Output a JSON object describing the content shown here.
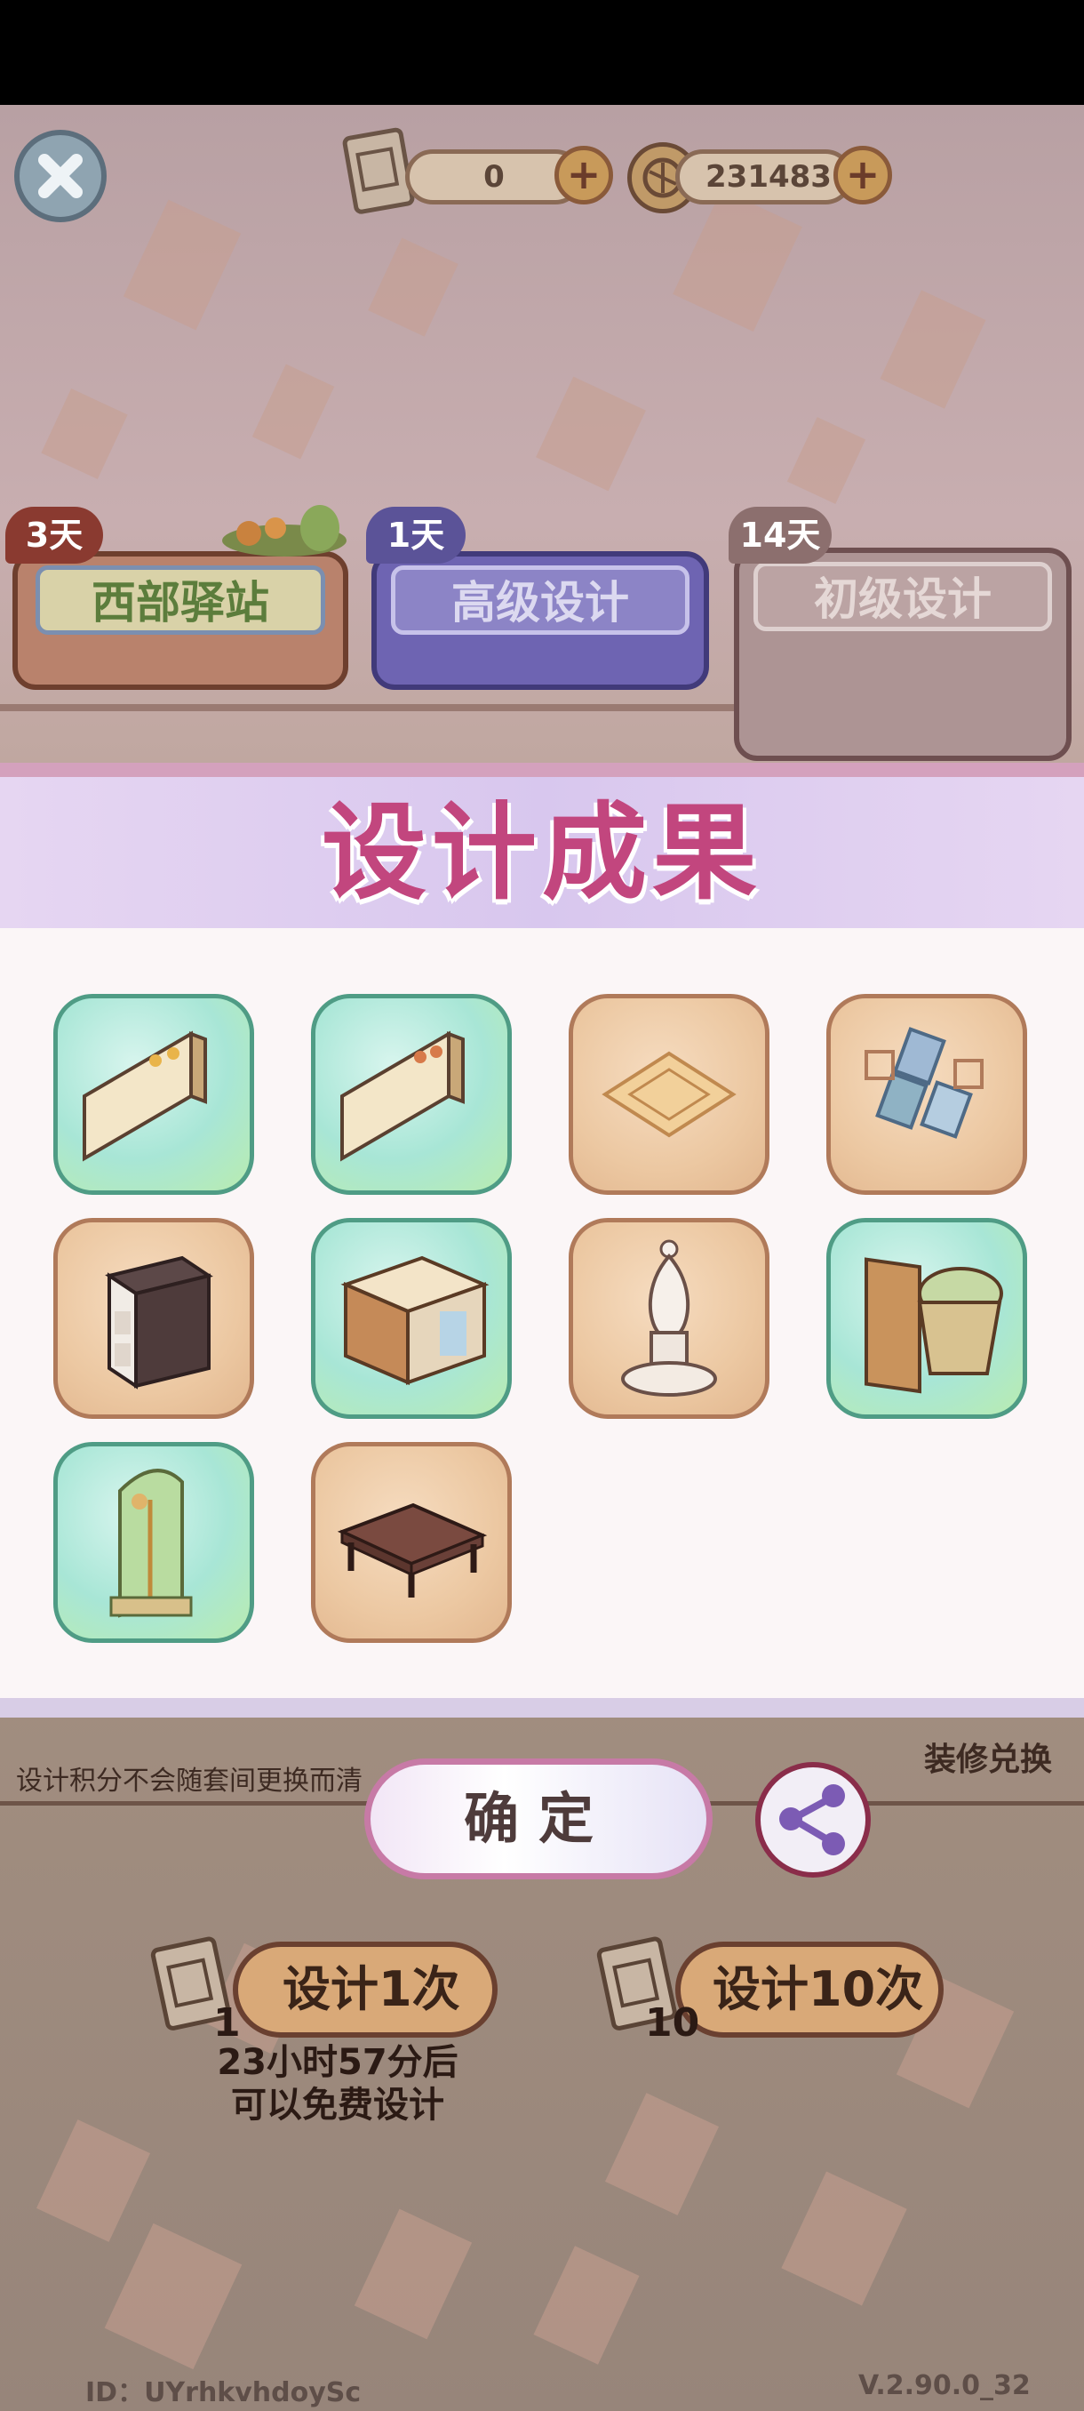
{
  "top_bar": {
    "scroll_count": "0",
    "coin_count": "231483"
  },
  "tabs": [
    {
      "days": "3天",
      "label": "西部驿站"
    },
    {
      "days": "1天",
      "label": "高级设计"
    },
    {
      "days": "14天",
      "label": "初级设计"
    }
  ],
  "modal": {
    "title": "设计成果",
    "items": [
      {
        "icon": "wall-panel-icon",
        "rarity": "green"
      },
      {
        "icon": "wall-panel-icon",
        "rarity": "green"
      },
      {
        "icon": "floor-rug-icon",
        "rarity": "tan"
      },
      {
        "icon": "geometric-decor-icon",
        "rarity": "tan"
      },
      {
        "icon": "nightstand-icon",
        "rarity": "tan"
      },
      {
        "icon": "cabinet-icon",
        "rarity": "green"
      },
      {
        "icon": "chess-bishop-icon",
        "rarity": "tan"
      },
      {
        "icon": "toilet-icon",
        "rarity": "green"
      },
      {
        "icon": "shower-icon",
        "rarity": "green"
      },
      {
        "icon": "coffee-table-icon",
        "rarity": "tan"
      }
    ]
  },
  "note": "设计积分不会随套间更换而清",
  "exchange_label": "装修兑换",
  "confirm_label": "确定",
  "design_once": {
    "label": "设计1次",
    "count": "1"
  },
  "design_ten": {
    "label": "设计10次",
    "count": "10"
  },
  "free_design_text": [
    "23小时57分后",
    "可以免费设计"
  ],
  "footer": {
    "id": "ID：UYrhkvhdoySc",
    "version": "V.2.90.0_32"
  },
  "colors": {
    "title_pink": "#c2467e",
    "green_frame": "#4f9c85",
    "tan_frame": "#b07a5a"
  }
}
